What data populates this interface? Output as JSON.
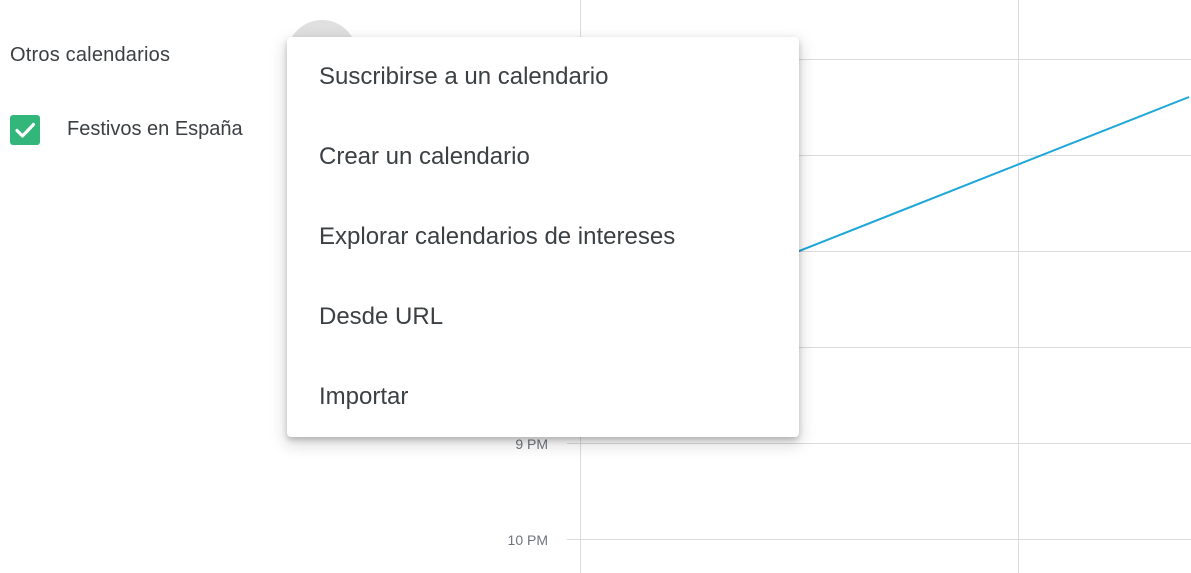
{
  "sidebar": {
    "section_title": "Otros calendarios",
    "calendars": [
      {
        "label": "Festivos en España",
        "checked": true,
        "color": "#33b679"
      }
    ],
    "add_button_icon": "plus-icon"
  },
  "menu": {
    "items": [
      {
        "label": "Suscribirse a un calendario"
      },
      {
        "label": "Crear un calendario"
      },
      {
        "label": "Explorar calendarios de intereses"
      },
      {
        "label": "Desde URL"
      },
      {
        "label": "Importar"
      }
    ]
  },
  "grid": {
    "time_labels": [
      "9 PM",
      "10 PM"
    ]
  },
  "colors": {
    "annotation_line": "#1ea7d8",
    "checkbox": "#33b679",
    "gridline": "#dadce0"
  }
}
